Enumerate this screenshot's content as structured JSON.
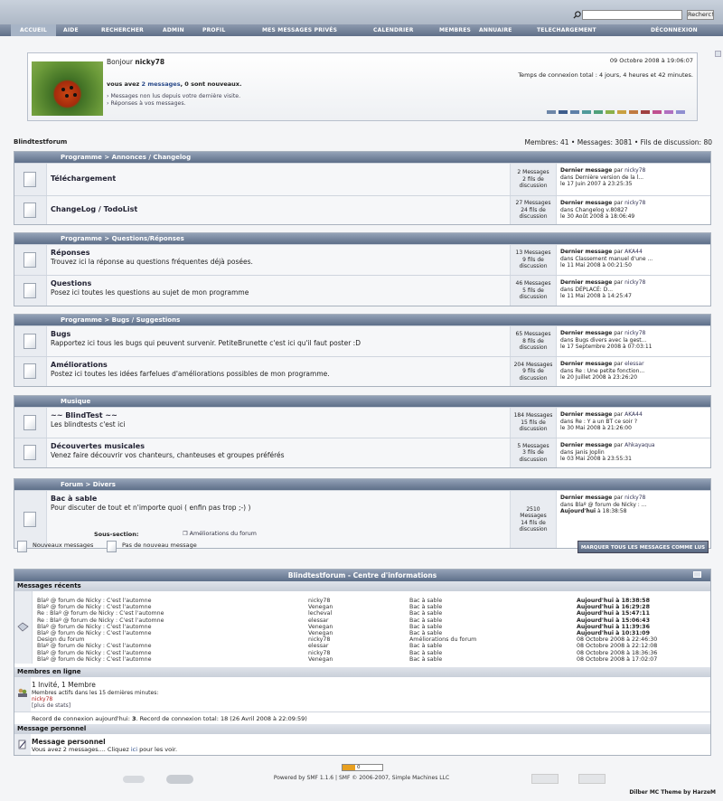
{
  "search": {
    "value": "",
    "button": "Recherc!"
  },
  "menu": [
    {
      "label": "ACCUEIL",
      "active": true
    },
    {
      "label": "AIDE"
    },
    {
      "label": "RECHERCHER"
    },
    {
      "label": "ADMIN"
    },
    {
      "label": "PROFIL"
    },
    {
      "label": "MES MESSAGES PRIVÉS"
    },
    {
      "label": "CALENDRIER"
    },
    {
      "label": "MEMBRES"
    },
    {
      "label": "ANNUAIRE"
    },
    {
      "label": "TELECHARGEMENT"
    },
    {
      "label": "DÉCONNEXION"
    }
  ],
  "user": {
    "greeting": "Bonjour",
    "name": "nicky78",
    "messages_line_pre": "vous avez",
    "messages_link": "2 messages",
    "messages_line_post": ", 0 sont nouveaux.",
    "link_unread": "› Messages non lus depuis votre dernière visite.",
    "link_replies": "› Réponses à vos messages.",
    "date": "09 Octobre 2008 à 19:06:07",
    "connection_time": "Temps de connexion total : 4 jours, 4 heures et 42 minutes."
  },
  "swatches": [
    "#6d86a8",
    "#3d5c8c",
    "#5c7fa8",
    "#4f9a9a",
    "#4fa07a",
    "#8ab04a",
    "#c8a040",
    "#c07a40",
    "#a04040",
    "#c05090",
    "#b070c0",
    "#8f8fd0"
  ],
  "board": {
    "title": "Blindtestforum",
    "stats": "Membres: 41  •  Messages: 3081  •  Fils de discussion: 80"
  },
  "categories": [
    {
      "title": "Programme > Annonces / Changelog",
      "boards": [
        {
          "name": "Téléchargement",
          "desc": "",
          "messages": "2 Messages",
          "topics": "2 fils de",
          "topics2": "discussion",
          "last_label": "Dernier message",
          "last_by": " par ",
          "last_user": "nicky78",
          "last_in": "dans Dernière version de la l...",
          "last_date": "le 17 Juin 2007 à 23:25:35"
        },
        {
          "name": "ChangeLog / TodoList",
          "desc": "",
          "messages": "27 Messages",
          "topics": "24 fils de",
          "topics2": "discussion",
          "last_label": "Dernier message",
          "last_by": " par ",
          "last_user": "nicky78",
          "last_in": "dans Changelog v.80827",
          "last_date": "le 30 Août 2008 à 18:06:49"
        }
      ]
    },
    {
      "title": "Programme > Questions/Réponses",
      "boards": [
        {
          "name": "Réponses",
          "desc": "Trouvez ici la réponse au questions fréquentes déjà posées.",
          "messages": "13 Messages",
          "topics": "9 fils de",
          "topics2": "discussion",
          "last_label": "Dernier message",
          "last_by": " par ",
          "last_user": "AKA44",
          "last_in": "dans Classement manuel d'une ...",
          "last_date": "le 11 Mai 2008 à 00:21:50"
        },
        {
          "name": "Questions",
          "desc": "Posez ici toutes les questions au sujet de mon programme",
          "messages": "46 Messages",
          "topics": "5 fils de",
          "topics2": "discussion",
          "last_label": "Dernier message",
          "last_by": " par ",
          "last_user": "nicky78",
          "last_in": "dans DÉPLACÉ: D...",
          "last_date": "le 11 Mai 2008 à 14:25:47"
        }
      ]
    },
    {
      "title": "Programme > Bugs / Suggestions",
      "boards": [
        {
          "name": "Bugs",
          "desc": "Rapportez ici tous les bugs qui peuvent survenir. PetiteBrunette c'est ici qu'il faut poster :D",
          "messages": "65 Messages",
          "topics": "8 fils de",
          "topics2": "discussion",
          "last_label": "Dernier message",
          "last_by": " par ",
          "last_user": "nicky78",
          "last_in": "dans Bugs divers avec la gest...",
          "last_date": "le 17 Septembre 2008 à 07:03:11"
        },
        {
          "name": "Améliorations",
          "desc": "Postez ici toutes les idées farfelues d'améliorations possibles de mon programme.",
          "messages": "204 Messages",
          "topics": "9 fils de",
          "topics2": "discussion",
          "last_label": "Dernier message",
          "last_by": " par ",
          "last_user": "elessar",
          "last_in": "dans Re : Une petite fonction...",
          "last_date": "le 20 Juillet 2008 à 23:26:20"
        }
      ]
    },
    {
      "title": "Musique",
      "boards": [
        {
          "name": "~~ BlindTest ~~",
          "desc": "Les blindtests c'est ici",
          "messages": "184 Messages",
          "topics": "15 fils de",
          "topics2": "discussion",
          "last_label": "Dernier message",
          "last_by": " par ",
          "last_user": "AKA44",
          "last_in": "dans Re : Y a un BT ce soir ?",
          "last_date": "le 30 Mai 2008 à 21:26:00"
        },
        {
          "name": "Découvertes musicales",
          "desc": "Venez faire découvrir vos chanteurs, chanteuses et groupes préférés",
          "messages": "5 Messages",
          "topics": "3 fils de",
          "topics2": "discussion",
          "last_label": "Dernier message",
          "last_by": " par ",
          "last_user": "Ahkayaqua",
          "last_in": "dans Janis Joplin",
          "last_date": "le 03 Mai 2008 à 23:55:31"
        }
      ]
    },
    {
      "title": "Forum > Divers",
      "boards": [
        {
          "name": "Bac à sable",
          "desc": "Pour discuter de tout et n'importe quoi ( enfin pas trop ;-) )",
          "messages": "2510",
          "messages2": "Messages",
          "topics": "14 fils de",
          "topics2": "discussion",
          "last_label": "Dernier message",
          "last_by": " par ",
          "last_user": "nicky78",
          "last_in": "dans Blaº @ forum de Nicky : ...",
          "last_date_b": "Aujourd'hui",
          "last_date": " à 18:38:58",
          "subsection_label": "Sous-section:",
          "subsection": "Améliorations du forum"
        }
      ]
    }
  ],
  "legend": {
    "new": "Nouveaux messages",
    "none": "Pas de nouveau message",
    "mark_all": "MARQUER TOUS LES MESSAGES COMME LUS"
  },
  "info": {
    "title": "Blindtestforum - Centre d'informations",
    "recent_title": "Messages récents",
    "recent": [
      {
        "subject": "Blaº @ forum de Nicky : C'est l'automne",
        "user": "nicky78",
        "board": "Bac à sable",
        "date": "Aujourd'hui à 18:38:58",
        "bold": true
      },
      {
        "subject": "Blaº @ forum de Nicky : C'est l'automne",
        "user": "Venegan",
        "board": "Bac à sable",
        "date": "Aujourd'hui à 16:29:28",
        "bold": true
      },
      {
        "subject": "Re : Blaº @ forum de Nicky : C'est l'automne",
        "user": "lecheval",
        "board": "Bac à sable",
        "date": "Aujourd'hui à 15:47:11",
        "bold": true
      },
      {
        "subject": "Re : Blaº @ forum de Nicky : C'est l'automne",
        "user": "elessar",
        "board": "Bac à sable",
        "date": "Aujourd'hui à 15:06:43",
        "bold": true
      },
      {
        "subject": "Blaº @ forum de Nicky : C'est l'automne",
        "user": "Venegan",
        "board": "Bac à sable",
        "date": "Aujourd'hui à 11:39:36",
        "bold": true
      },
      {
        "subject": "Blaº @ forum de Nicky : C'est l'automne",
        "user": "Venegan",
        "board": "Bac à sable",
        "date": "Aujourd'hui à 10:31:09",
        "bold": true
      },
      {
        "subject": "Design du forum",
        "user": "nicky78",
        "board": "Améliorations du forum",
        "date": "08 Octobre 2008 à 22:46:30",
        "bold": false
      },
      {
        "subject": "Blaº @ forum de Nicky : C'est l'automne",
        "user": "elessar",
        "board": "Bac à sable",
        "date": "08 Octobre 2008 à 22:12:08",
        "bold": false
      },
      {
        "subject": "Blaº @ forum de Nicky : C'est l'automne",
        "user": "nicky78",
        "board": "Bac à sable",
        "date": "08 Octobre 2008 à 18:36:36",
        "bold": false
      },
      {
        "subject": "Blaº @ forum de Nicky : C'est l'automne",
        "user": "Venegan",
        "board": "Bac à sable",
        "date": "08 Octobre 2008 à 17:02:07",
        "bold": false
      }
    ],
    "online_title": "Membres en ligne",
    "online_count": "1 Invité, 1 Membre",
    "online_active": "Membres actifs dans les 15 dernières minutes:",
    "online_user": "nicky78",
    "online_more": "[plus de stats]",
    "record_pre": "Record de connexion aujourd'hui: ",
    "record_today": "3",
    "record_post": ".  Record de connexion total: 18 (26 Avril 2008 à 22:09:59)",
    "pm_title": "Message personnel",
    "pm_label": "Message personnel",
    "pm_text_pre": "Vous avez 2 messages.... Cliquez ",
    "pm_link": "ici",
    "pm_text_post": " pour les voir."
  },
  "footer": {
    "counter": "0",
    "powered": "Powered by SMF 1.1.6 | SMF © 2006-2007, Simple Machines LLC",
    "theme": "Dilber MC Theme by HarzeM"
  }
}
